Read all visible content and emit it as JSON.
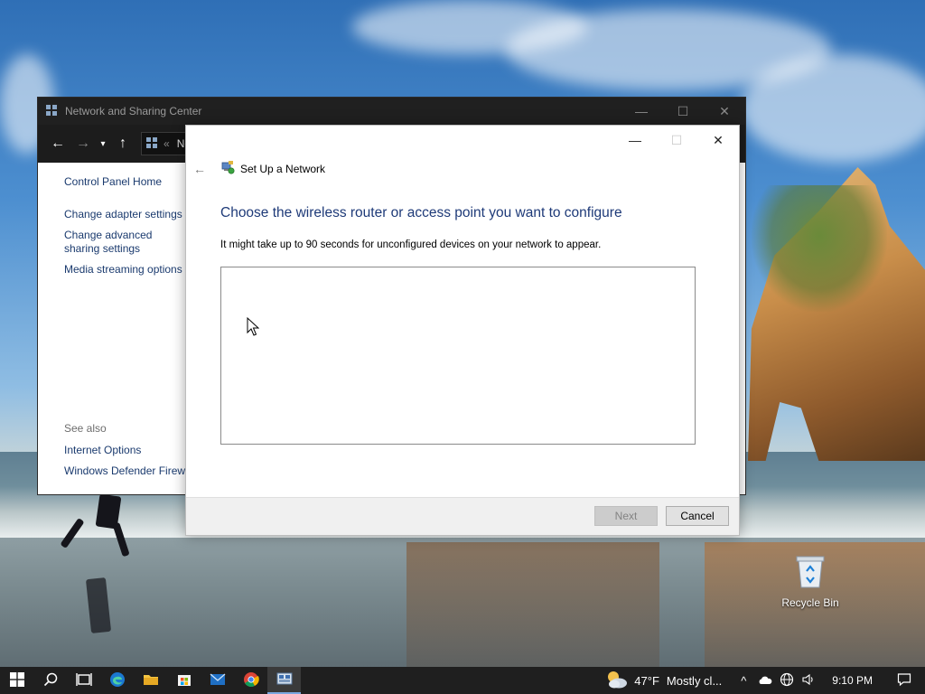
{
  "back_window": {
    "title": "Network and Sharing Center",
    "address_text": "Ne",
    "sidebar_links": [
      "Control Panel Home",
      "Change adapter settings",
      "Change advanced sharing settings",
      "Media streaming options"
    ],
    "see_also_heading": "See also",
    "see_also_links": [
      "Internet Options",
      "Windows Defender Firewall"
    ]
  },
  "wizard": {
    "title": "Set Up a Network",
    "heading": "Choose the wireless router or access point you want to configure",
    "description": "It might take up to 90 seconds for unconfigured devices on your network to appear.",
    "next_label": "Next",
    "cancel_label": "Cancel",
    "next_enabled": false
  },
  "desktop": {
    "recycle_bin_label": "Recycle Bin"
  },
  "taskbar": {
    "pinned": [
      "start-icon",
      "search-icon",
      "task-view-icon",
      "edge-icon",
      "file-explorer-icon",
      "microsoft-store-icon",
      "mail-icon",
      "chrome-icon",
      "network-setup-icon"
    ],
    "weather_temp": "47°F",
    "weather_condition": "Mostly cl...",
    "clock": "9:10 PM"
  },
  "colors": {
    "accent_blue": "#1e3a78",
    "link_blue": "#1a3a6e",
    "taskbar_bg": "#1f1f1f",
    "titlebar_dark": "#202020"
  }
}
